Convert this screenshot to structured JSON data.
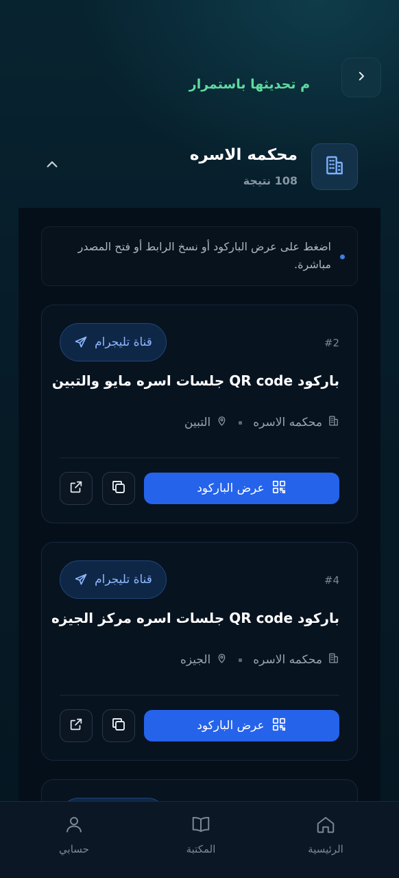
{
  "header": {
    "marquee_text": "م تحديثها باستمرار",
    "back_icon": "chevron-right-icon"
  },
  "section": {
    "title": "محكمه الاسره",
    "count": "108 نتيجة",
    "icon": "building-icon"
  },
  "hint": {
    "text": "اضغط على عرض الباركود أو نسخ الرابط أو فتح المصدر مباشرة."
  },
  "cards": [
    {
      "number": "#2",
      "chip": "قناة تليجرام",
      "title": "باركود QR code جلسات اسره مايو والتبين",
      "court": "محكمه الاسره",
      "location": "التبين",
      "button": "عرض الباركود"
    },
    {
      "number": "#4",
      "chip": "قناة تليجرام",
      "title": "باركود QR code جلسات اسره مركز الجيزه",
      "court": "محكمه الاسره",
      "location": "الجيزه",
      "button": "عرض الباركود"
    }
  ],
  "nav": {
    "home": "الرئيسية",
    "library": "المكتبة",
    "account": "حسابي"
  },
  "colors": {
    "accent": "#2563eb",
    "marquee": "#5fdc9f",
    "chip_text": "#8fb8ff"
  }
}
